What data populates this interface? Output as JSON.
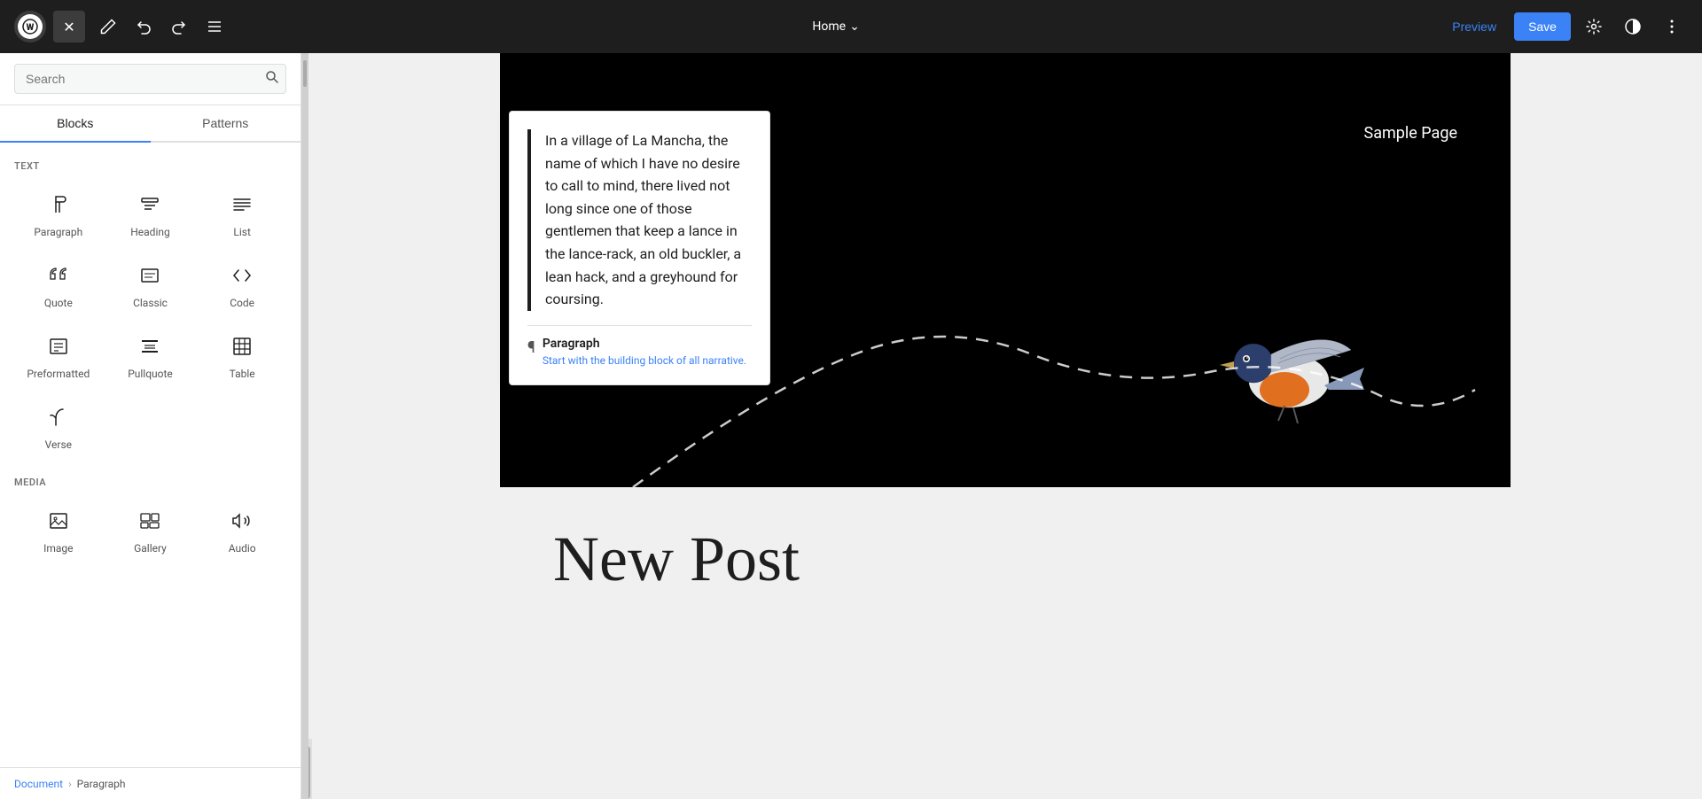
{
  "topbar": {
    "wp_logo": "W",
    "close_label": "✕",
    "edit_icon": "✏",
    "undo_icon": "↩",
    "redo_icon": "↪",
    "menu_icon": "≡",
    "page_title": "Home",
    "chevron_icon": "⌄",
    "preview_label": "Preview",
    "save_label": "Save",
    "settings_icon": "⚙",
    "contrast_icon": "◑",
    "more_icon": "⋮"
  },
  "sidebar": {
    "search_placeholder": "Search",
    "search_icon": "🔍",
    "tab_blocks": "Blocks",
    "tab_patterns": "Patterns",
    "text_section_label": "TEXT",
    "blocks": [
      {
        "id": "paragraph",
        "icon": "¶",
        "label": "Paragraph"
      },
      {
        "id": "heading",
        "icon": "🔖",
        "label": "Heading"
      },
      {
        "id": "list",
        "icon": "≡",
        "label": "List"
      },
      {
        "id": "quote",
        "icon": "❝",
        "label": "Quote"
      },
      {
        "id": "classic",
        "icon": "⌨",
        "label": "Classic"
      },
      {
        "id": "code",
        "icon": "<>",
        "label": "Code"
      },
      {
        "id": "preformatted",
        "icon": "▦",
        "label": "Preformatted"
      },
      {
        "id": "pullquote",
        "icon": "▬",
        "label": "Pullquote"
      },
      {
        "id": "table",
        "icon": "⊞",
        "label": "Table"
      },
      {
        "id": "verse",
        "icon": "✒",
        "label": "Verse"
      }
    ],
    "media_section_label": "MEDIA",
    "media_blocks": [
      {
        "id": "image",
        "icon": "🖼",
        "label": "Image"
      },
      {
        "id": "gallery",
        "icon": "⊟",
        "label": "Gallery"
      },
      {
        "id": "audio",
        "icon": "♪",
        "label": "Audio"
      }
    ]
  },
  "breadcrumb": {
    "document": "Document",
    "separator": "›",
    "paragraph": "Paragraph"
  },
  "canvas": {
    "sample_page": "Sample Page",
    "popup": {
      "text_part1": "n a village of La Mancha, the name of which I have no desire to call to mind, there lived not long since one of those gentlemen that keep a lance in the lance-rack, an old buckler, a lean hack, and a greyhound for coursing.",
      "para_icon": "¶",
      "para_title": "Paragraph",
      "para_desc": "Start with the building block of all narrative."
    },
    "new_post_title": "New Post"
  }
}
